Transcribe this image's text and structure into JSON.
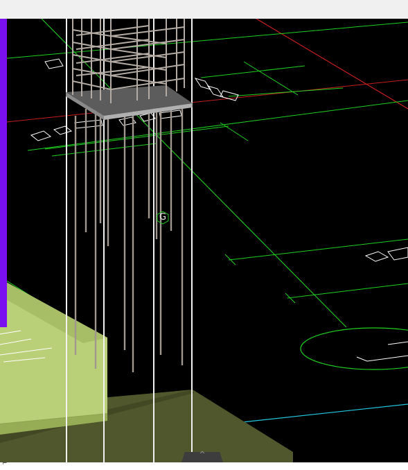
{
  "toolbar": {},
  "viewport": {
    "gizmo_label": "G",
    "collapse_glyph": "^",
    "colors": {
      "background": "#000000",
      "axis_green": "#1fd11f",
      "axis_red": "#c81e1e",
      "axis_cyan": "#22c8e0",
      "wall_purple": "#7a10f0",
      "foundation_light": "#b9cf78",
      "foundation_dark": "#50572c",
      "rebar_gray": "#a09890",
      "pile_white": "#f2f2f2"
    }
  },
  "status": {
    "corner_glyph": "⌐"
  }
}
